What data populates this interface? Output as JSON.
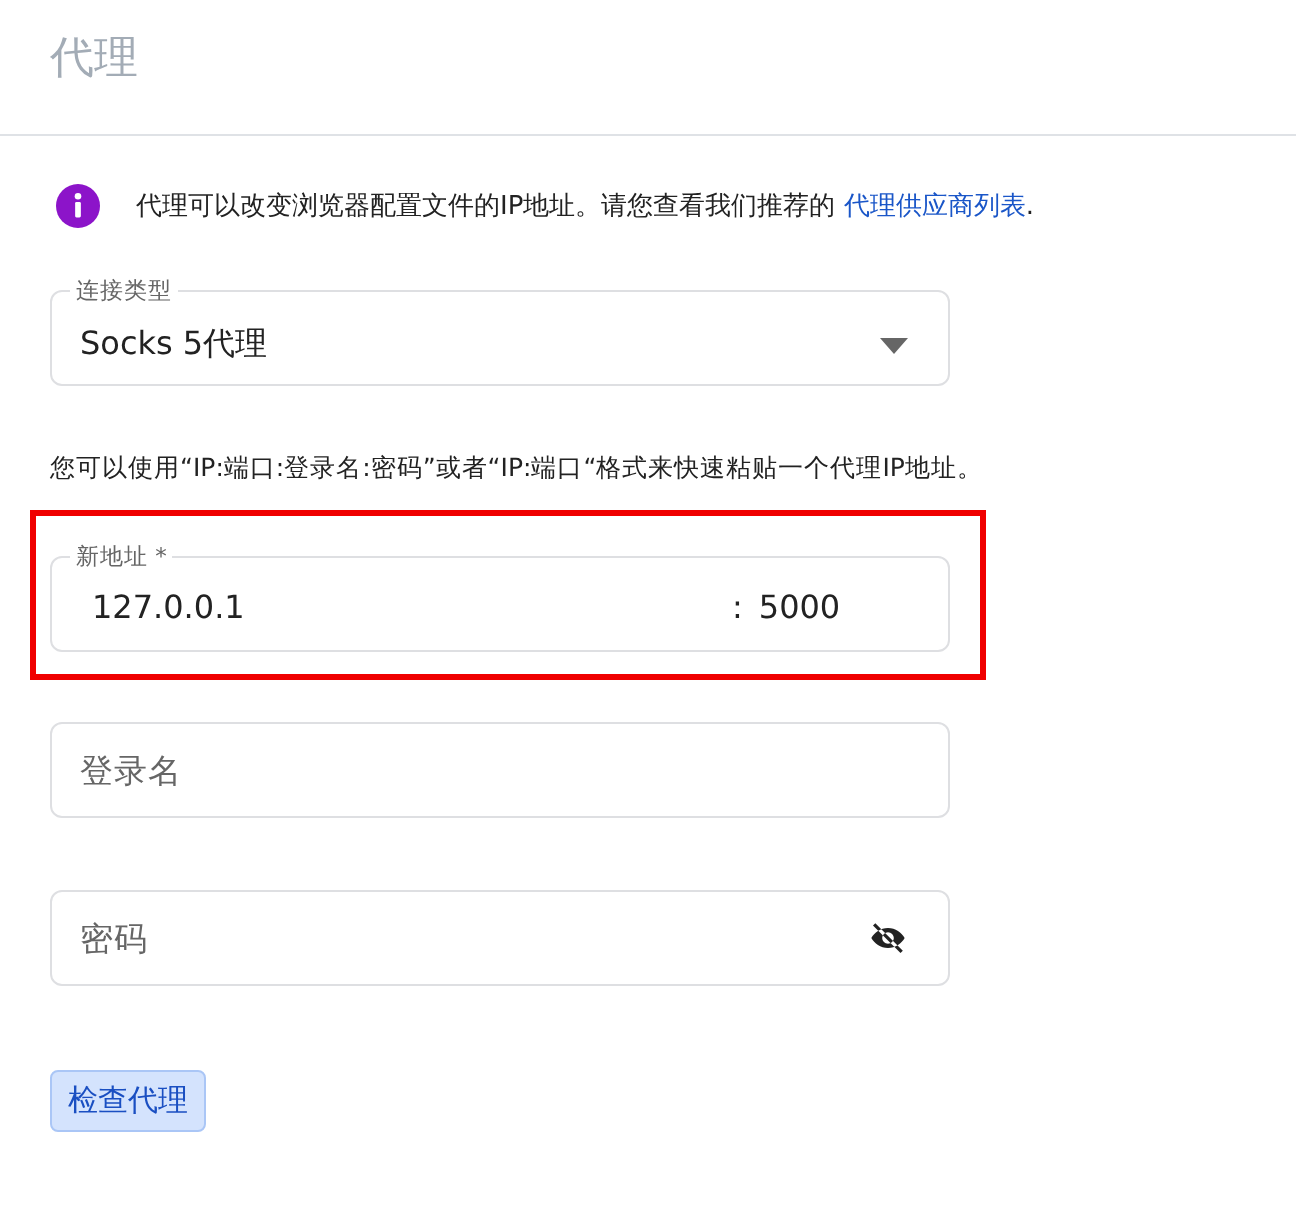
{
  "header": {
    "title": "代理"
  },
  "info": {
    "text": "代理可以改变浏览器配置文件的IP地址。请您查看我们推荐的",
    "link": "代理供应商列表",
    "after": "."
  },
  "connection_type": {
    "label": "连接类型",
    "value": "Socks 5代理"
  },
  "hint": "您可以使用“IP:端口:登录名:密码”或者“IP:端口“格式来快速粘贴一个代理IP地址。",
  "address": {
    "label": "新地址 *",
    "host": "127.0.0.1",
    "separator": ":",
    "port": "5000",
    "highlighted": true
  },
  "login": {
    "placeholder": "登录名"
  },
  "password": {
    "placeholder": "密码",
    "visible": false
  },
  "check_button": {
    "label": "检查代理"
  }
}
